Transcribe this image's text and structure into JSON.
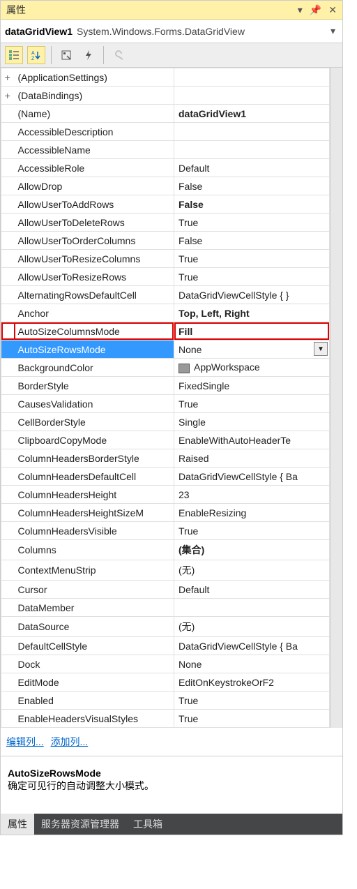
{
  "panel": {
    "title": "属性"
  },
  "object": {
    "name": "dataGridView1",
    "type": "System.Windows.Forms.DataGridView"
  },
  "links": {
    "edit_columns": "编辑列...",
    "add_column": "添加列..."
  },
  "help": {
    "title": "AutoSizeRowsMode",
    "desc": "确定可见行的自动调整大小模式。"
  },
  "tabs": {
    "properties": "属性",
    "server_explorer": "服务器资源管理器",
    "toolbox": "工具箱"
  },
  "properties": [
    {
      "name": "(ApplicationSettings)",
      "value": "",
      "exp": "+"
    },
    {
      "name": "(DataBindings)",
      "value": "",
      "exp": "+"
    },
    {
      "name": "(Name)",
      "value": "dataGridView1",
      "bold": true
    },
    {
      "name": "AccessibleDescription",
      "value": ""
    },
    {
      "name": "AccessibleName",
      "value": ""
    },
    {
      "name": "AccessibleRole",
      "value": "Default"
    },
    {
      "name": "AllowDrop",
      "value": "False"
    },
    {
      "name": "AllowUserToAddRows",
      "value": "False",
      "bold": true
    },
    {
      "name": "AllowUserToDeleteRows",
      "value": "True"
    },
    {
      "name": "AllowUserToOrderColumns",
      "value": "False"
    },
    {
      "name": "AllowUserToResizeColumns",
      "value": "True"
    },
    {
      "name": "AllowUserToResizeRows",
      "value": "True"
    },
    {
      "name": "AlternatingRowsDefaultCell",
      "value": "DataGridViewCellStyle { }"
    },
    {
      "name": "Anchor",
      "value": "Top, Left, Right",
      "bold": true
    },
    {
      "name": "AutoSizeColumnsMode",
      "value": "Fill",
      "bold": true,
      "highlight": true
    },
    {
      "name": "AutoSizeRowsMode",
      "value": "None",
      "selected": true,
      "dropdown": true
    },
    {
      "name": "BackgroundColor",
      "value": "AppWorkspace",
      "swatch": true
    },
    {
      "name": "BorderStyle",
      "value": "FixedSingle"
    },
    {
      "name": "CausesValidation",
      "value": "True"
    },
    {
      "name": "CellBorderStyle",
      "value": "Single"
    },
    {
      "name": "ClipboardCopyMode",
      "value": "EnableWithAutoHeaderTe"
    },
    {
      "name": "ColumnHeadersBorderStyle",
      "value": "Raised"
    },
    {
      "name": "ColumnHeadersDefaultCell",
      "value": "DataGridViewCellStyle { Ba"
    },
    {
      "name": "ColumnHeadersHeight",
      "value": "23"
    },
    {
      "name": "ColumnHeadersHeightSizeM",
      "value": "EnableResizing"
    },
    {
      "name": "ColumnHeadersVisible",
      "value": "True"
    },
    {
      "name": "Columns",
      "value": "(集合)",
      "bold": true
    },
    {
      "name": "ContextMenuStrip",
      "value": "(无)"
    },
    {
      "name": "Cursor",
      "value": "Default"
    },
    {
      "name": "DataMember",
      "value": ""
    },
    {
      "name": "DataSource",
      "value": "(无)"
    },
    {
      "name": "DefaultCellStyle",
      "value": "DataGridViewCellStyle { Ba"
    },
    {
      "name": "Dock",
      "value": "None"
    },
    {
      "name": "EditMode",
      "value": "EditOnKeystrokeOrF2"
    },
    {
      "name": "Enabled",
      "value": "True"
    },
    {
      "name": "EnableHeadersVisualStyles",
      "value": "True"
    }
  ]
}
